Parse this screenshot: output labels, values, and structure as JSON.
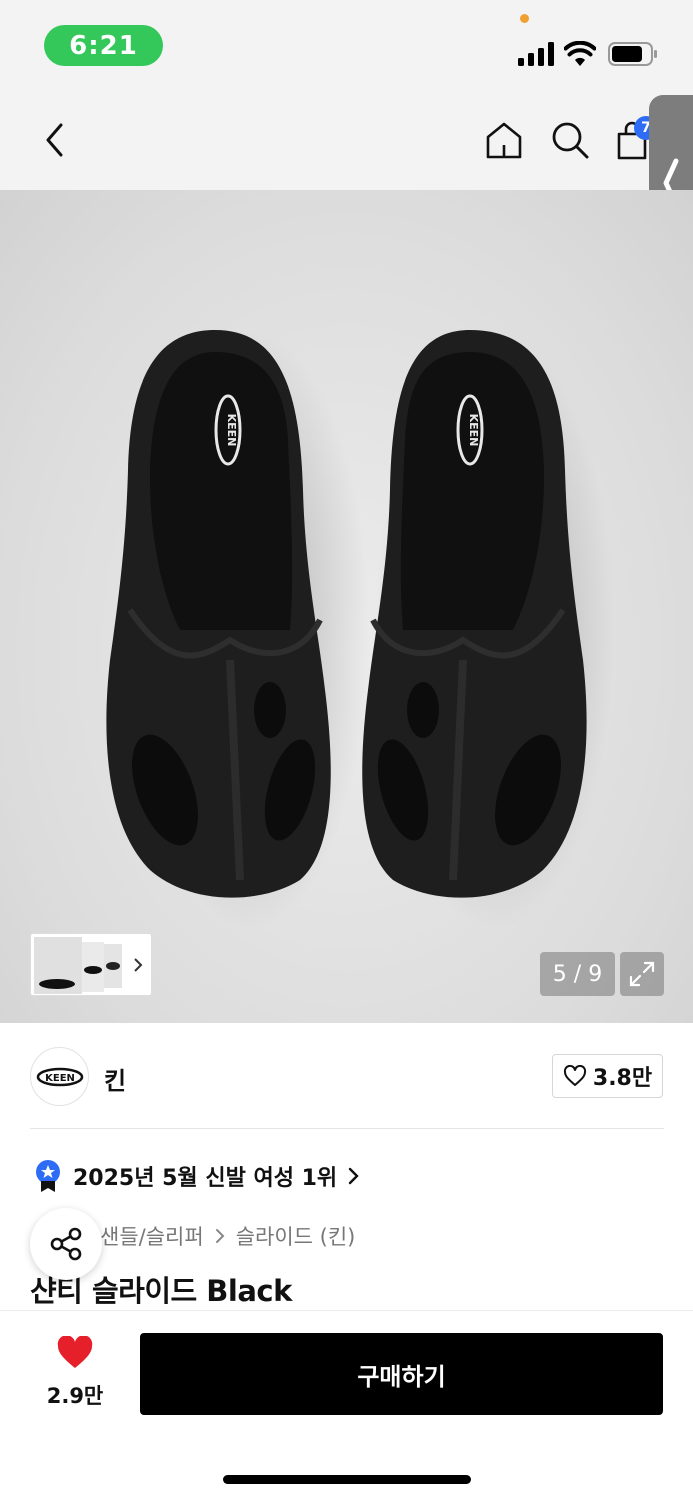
{
  "status_bar": {
    "time": "6:21",
    "icons": [
      "signal-icon",
      "wifi-icon",
      "battery-icon"
    ]
  },
  "nav": {
    "icons": [
      "back-icon",
      "home-icon",
      "search-icon",
      "cart-icon"
    ],
    "cart_badge": "7"
  },
  "gallery": {
    "image": "black-slide-sandals-pair",
    "logo_text": "KEEN",
    "counter": "5 / 9",
    "expand_icon": "expand-icon"
  },
  "brand": {
    "name": "킨",
    "logo_text": "KEEN",
    "likes": "3.8만"
  },
  "ranking": {
    "text": "2025년 5월 신발 여성 1위"
  },
  "category": {
    "level1": "샌들/슬리퍼",
    "level2": "슬라이드 (킨)"
  },
  "product": {
    "title": "샨티 슬라이드 Black"
  },
  "bottom": {
    "wish_count": "2.9만",
    "buy_label": "구매하기"
  },
  "colors": {
    "time_pill": "#34c759",
    "badge": "#2f6cf5",
    "heart": "#e5202a",
    "buy_button": "#000000"
  }
}
